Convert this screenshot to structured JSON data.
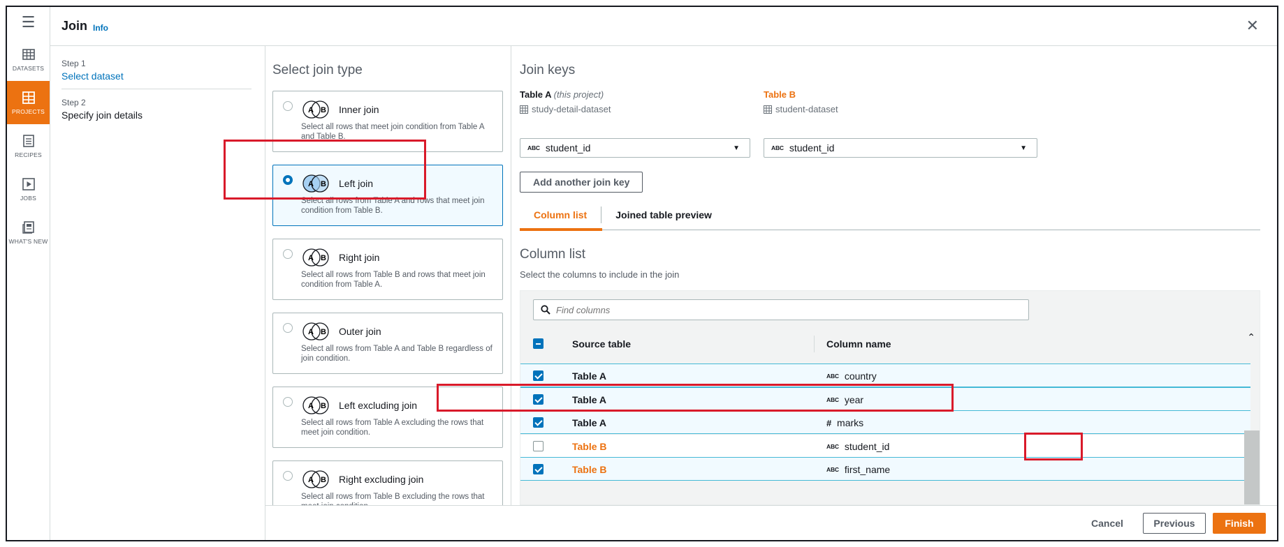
{
  "header": {
    "title": "Join",
    "info": "Info",
    "close_icon": "close-icon"
  },
  "rail": {
    "menu_icon": "hamburger-icon",
    "items": [
      {
        "label": "DATASETS",
        "icon": "table-icon",
        "active": false
      },
      {
        "label": "PROJECTS",
        "icon": "projects-icon",
        "active": true
      },
      {
        "label": "RECIPES",
        "icon": "list-icon",
        "active": false
      },
      {
        "label": "JOBS",
        "icon": "play-icon",
        "active": false
      },
      {
        "label": "WHAT'S NEW",
        "icon": "news-icon",
        "active": false
      }
    ]
  },
  "steps": [
    {
      "number": "Step 1",
      "name": "Select dataset",
      "link": true
    },
    {
      "number": "Step 2",
      "name": "Specify join details",
      "link": false
    }
  ],
  "join_type": {
    "heading": "Select join type",
    "options": [
      {
        "name": "Inner join",
        "desc": "Select all rows that meet join condition from Table A and Table B.",
        "selected": false
      },
      {
        "name": "Left join",
        "desc": "Select all rows from Table A and rows that meet join condition from Table B.",
        "selected": true
      },
      {
        "name": "Right join",
        "desc": "Select all rows from Table B and rows that meet join condition from Table A.",
        "selected": false
      },
      {
        "name": "Outer join",
        "desc": "Select all rows from Table A and Table B regardless of join condition.",
        "selected": false
      },
      {
        "name": "Left excluding join",
        "desc": "Select all rows from Table A excluding the rows that meet join condition.",
        "selected": false
      },
      {
        "name": "Right excluding join",
        "desc": "Select all rows from Table B excluding the rows that meet join condition.",
        "selected": false
      }
    ],
    "venn_a": "A",
    "venn_b": "B"
  },
  "join_keys": {
    "heading": "Join keys",
    "table_a": {
      "label": "Table A",
      "sub": "(this project)",
      "dataset": "study-detail-dataset",
      "key": "student_id",
      "type_badge": "ABC"
    },
    "table_b": {
      "label": "Table B",
      "dataset": "student-dataset",
      "key": "student_id",
      "type_badge": "ABC"
    },
    "add_key_label": "Add another join key"
  },
  "tabs": [
    {
      "label": "Column list",
      "active": true
    },
    {
      "label": "Joined table preview",
      "active": false
    }
  ],
  "column_list": {
    "heading": "Column list",
    "subtitle": "Select the columns to include in the join",
    "search_placeholder": "Find columns",
    "headers": {
      "source": "Source table",
      "column": "Column name"
    },
    "rows": [
      {
        "source": "Table A",
        "type": "ABC",
        "column": "country",
        "checked": true,
        "is_b": false
      },
      {
        "source": "Table A",
        "type": "ABC",
        "column": "year",
        "checked": true,
        "is_b": false
      },
      {
        "source": "Table A",
        "type": "#",
        "column": "marks",
        "checked": true,
        "is_b": false
      },
      {
        "source": "Table B",
        "type": "ABC",
        "column": "student_id",
        "checked": false,
        "is_b": true
      },
      {
        "source": "Table B",
        "type": "ABC",
        "column": "first_name",
        "checked": true,
        "is_b": true
      }
    ]
  },
  "footer": {
    "cancel": "Cancel",
    "previous": "Previous",
    "finish": "Finish"
  },
  "colors": {
    "accent": "#ec7211",
    "link": "#0073bb",
    "highlight": "#d91a2a"
  }
}
